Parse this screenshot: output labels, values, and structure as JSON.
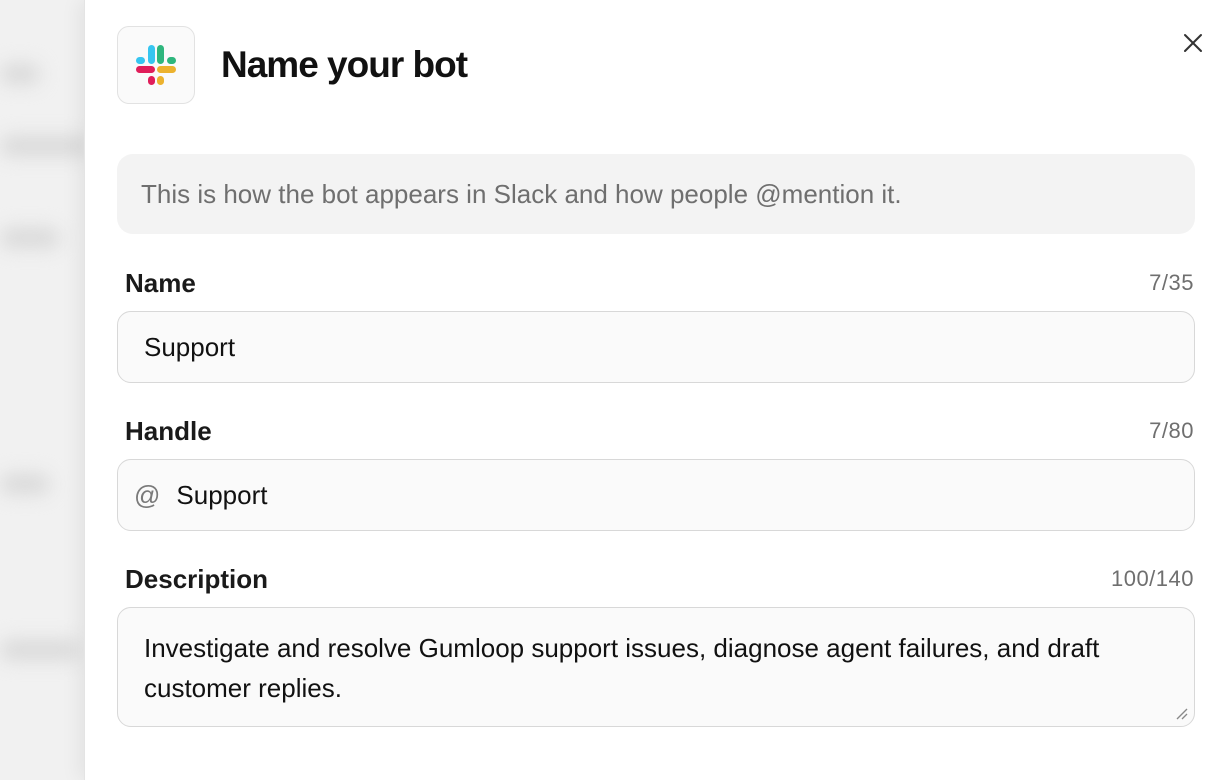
{
  "header": {
    "title": "Name your bot",
    "logo_icon": "slack-logo-icon",
    "close_icon": "close-icon"
  },
  "info": {
    "text": "This is how the bot appears in Slack and how people @mention it."
  },
  "fields": {
    "name": {
      "label": "Name",
      "count": "7/35",
      "value": "Support"
    },
    "handle": {
      "label": "Handle",
      "count": "7/80",
      "prefix": "@",
      "value": "Support"
    },
    "description": {
      "label": "Description",
      "count": "100/140",
      "value": "Investigate and resolve Gumloop support issues, diagnose agent failures, and draft customer replies."
    }
  },
  "colors": {
    "slack_blue": "#36C5F0",
    "slack_green": "#2EB67D",
    "slack_red": "#E01E5A",
    "slack_yellow": "#ECB22E"
  }
}
